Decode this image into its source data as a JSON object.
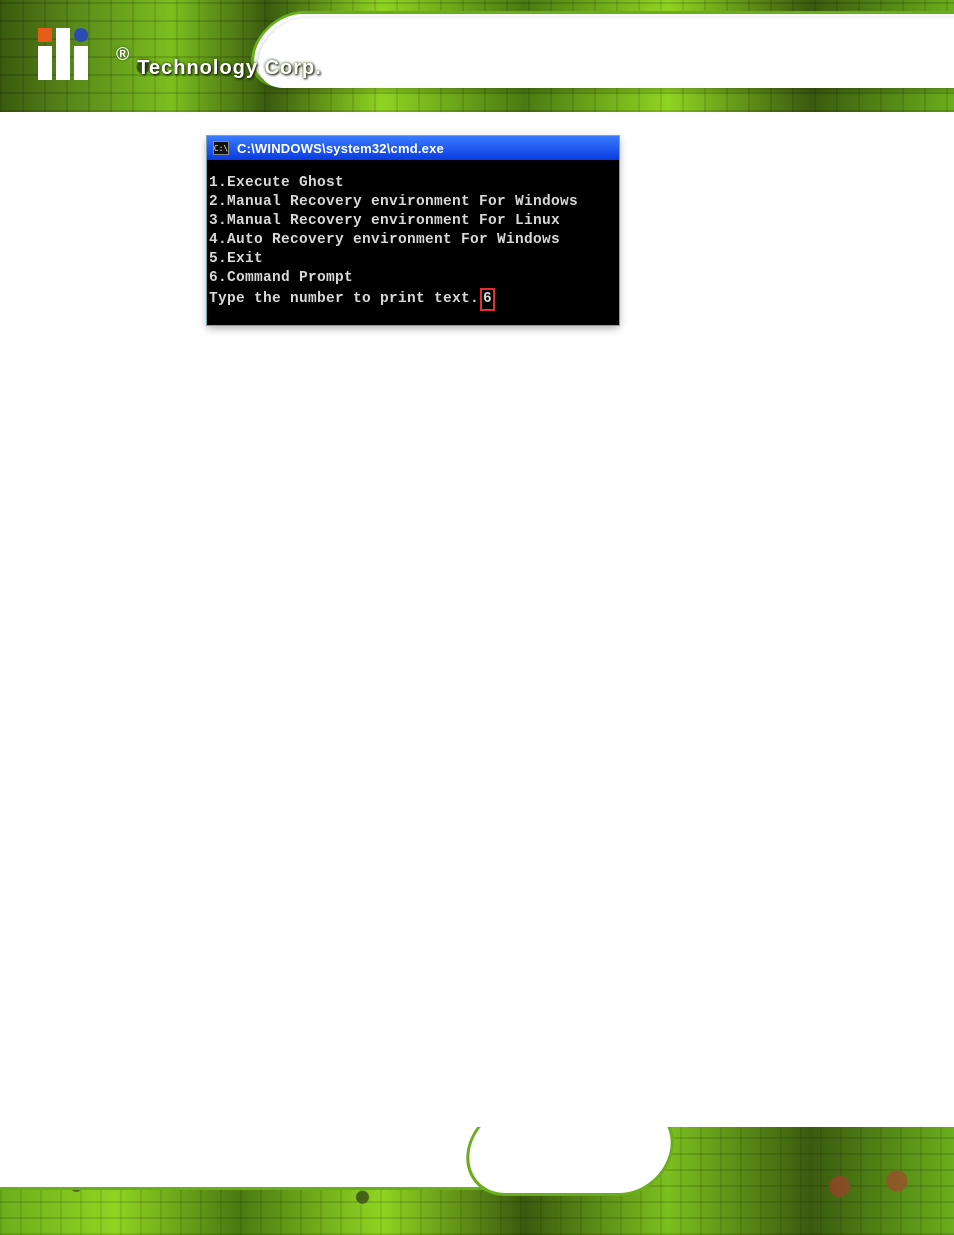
{
  "brand": {
    "reg_symbol": "®",
    "name": "Technology Corp."
  },
  "terminal": {
    "icon_text": "C:\\",
    "title": "C:\\WINDOWS\\system32\\cmd.exe",
    "menu": [
      "1.Execute Ghost",
      "2.Manual Recovery environment For Windows",
      "3.Manual Recovery environment For Linux",
      "4.Auto Recovery environment For Windows",
      "5.Exit",
      "6.Command Prompt"
    ],
    "prompt": "Type the number to print text.",
    "input_value": "6"
  }
}
